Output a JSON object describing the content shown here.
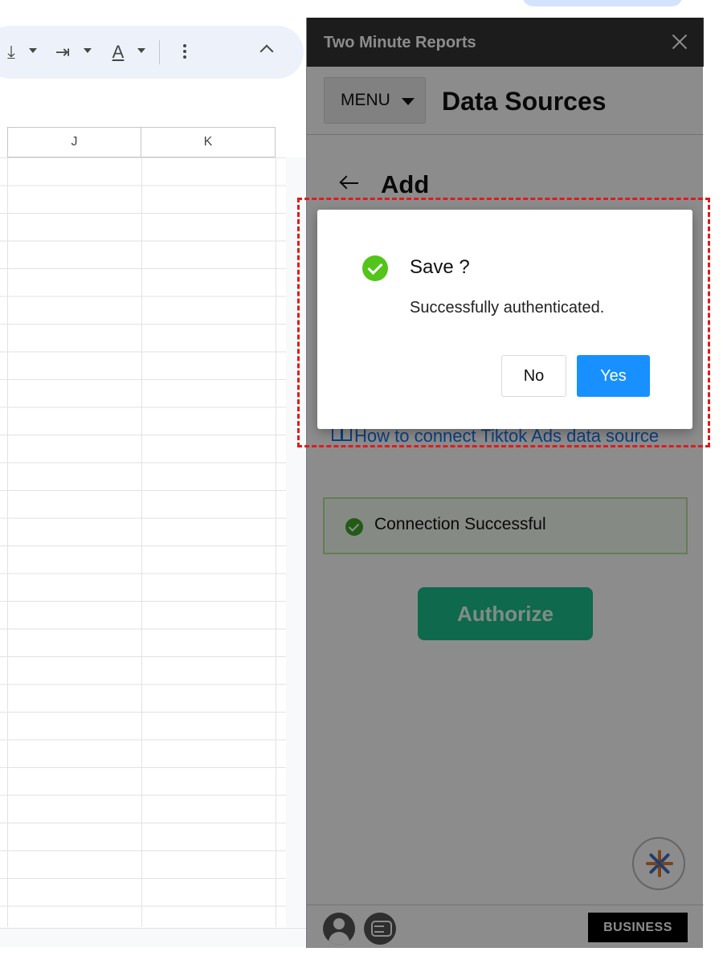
{
  "spreadsheet": {
    "toolbar_icons": [
      "align-bottom-icon",
      "text-direction-icon",
      "text-color-icon",
      "more-vert-icon",
      "collapse-icon"
    ],
    "columns": [
      "J",
      "K"
    ]
  },
  "sidebar": {
    "title": "Two Minute Reports",
    "menu_label": "MENU",
    "page_title": "Data Sources",
    "section_title": "Add",
    "help_link": "How to connect Tiktok Ads data source",
    "connection_status": "Connection Successful",
    "authorize_label": "Authorize",
    "plan_badge": "BUSINESS"
  },
  "dialog": {
    "title": "Save ?",
    "message": "Successfully authenticated.",
    "no_label": "No",
    "yes_label": "Yes"
  },
  "colors": {
    "header_bg": "#333333",
    "primary_button": "#1890ff",
    "success": "#52c41a",
    "authorize": "#1dbf8a",
    "highlight": "#e01b1b"
  }
}
